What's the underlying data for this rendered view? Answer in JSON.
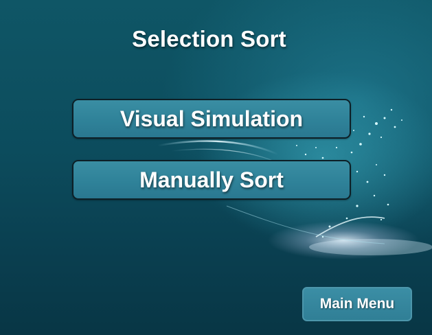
{
  "page": {
    "title": "Selection Sort"
  },
  "menu": {
    "visual_simulation_label": "Visual Simulation",
    "manually_sort_label": "Manually Sort"
  },
  "footer": {
    "main_menu_label": "Main Menu"
  },
  "colors": {
    "background": "#0b4a5a",
    "button_fill": "#2f8299",
    "button_border": "#0d1f26",
    "text": "#ffffff"
  }
}
